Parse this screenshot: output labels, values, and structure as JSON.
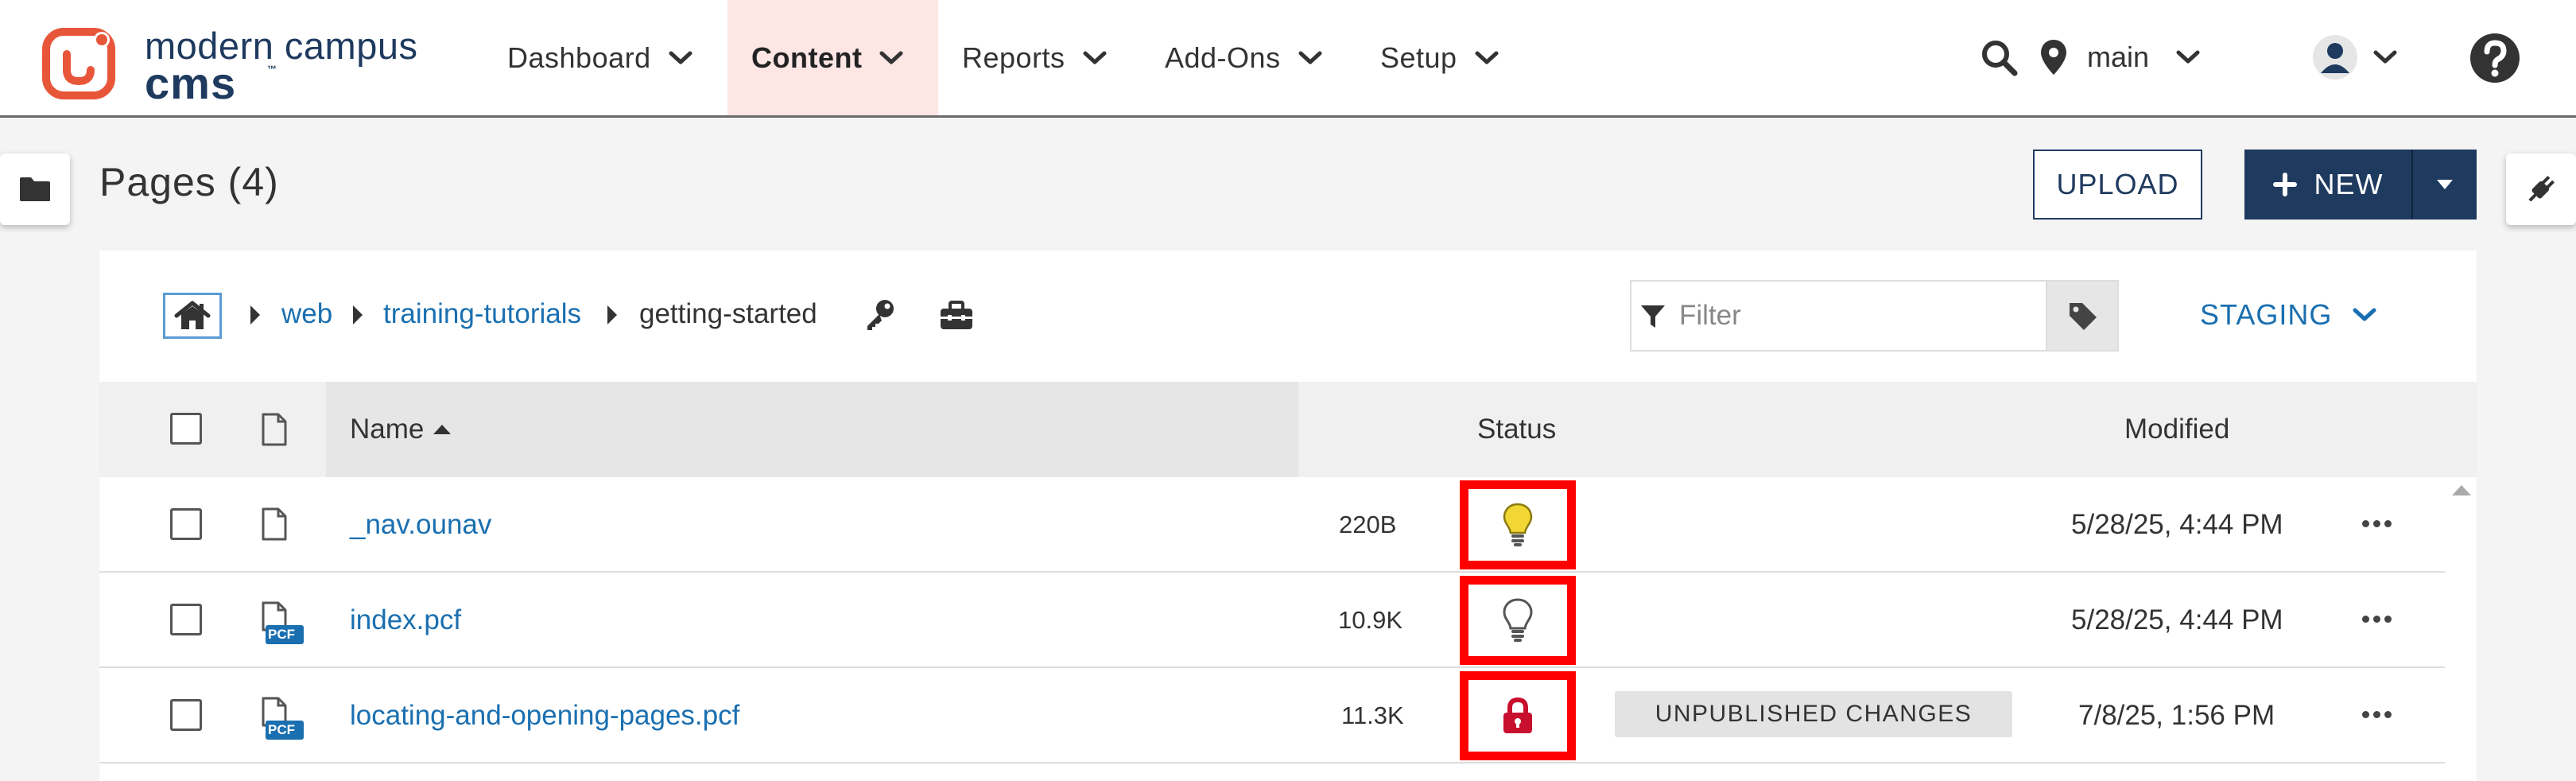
{
  "logo": {
    "line1": "modern campus",
    "line2": "cms",
    "tm": "™"
  },
  "nav": {
    "items": [
      {
        "label": "Dashboard"
      },
      {
        "label": "Content"
      },
      {
        "label": "Reports"
      },
      {
        "label": "Add-Ons"
      },
      {
        "label": "Setup"
      }
    ]
  },
  "topbar": {
    "branch": "main"
  },
  "header": {
    "title": "Pages (4)",
    "upload_label": "UPLOAD",
    "new_label": "NEW"
  },
  "breadcrumb": {
    "items": [
      {
        "label": "web"
      },
      {
        "label": "training-tutorials"
      },
      {
        "label": "getting-started"
      }
    ]
  },
  "filter": {
    "placeholder": "Filter"
  },
  "environment": {
    "label": "STAGING"
  },
  "table": {
    "columns": {
      "name": "Name",
      "status": "Status",
      "modified": "Modified"
    },
    "rows": [
      {
        "name": "_nav.ounav",
        "size": "220B",
        "status_icon": "bulb-on-icon",
        "badge": "",
        "modified": "5/28/25, 4:44 PM"
      },
      {
        "name": "index.pcf",
        "size": "10.9K",
        "file_badge": "PCF",
        "status_icon": "bulb-off-icon",
        "badge": "",
        "modified": "5/28/25, 4:44 PM"
      },
      {
        "name": "locating-and-opening-pages.pcf",
        "size": "11.3K",
        "file_badge": "PCF",
        "status_icon": "lock-icon",
        "badge": "UNPUBLISHED CHANGES",
        "modified": "7/8/25, 1:56 PM"
      }
    ]
  },
  "colors": {
    "brand_navy": "#1f3a5f",
    "logo_orange": "#e8563a",
    "link_blue": "#1a6fb0",
    "highlight_red": "#ff0000",
    "bulb_yellow": "#f2d633",
    "lock_red": "#c8102e",
    "active_nav_bg": "#fde6e4"
  }
}
